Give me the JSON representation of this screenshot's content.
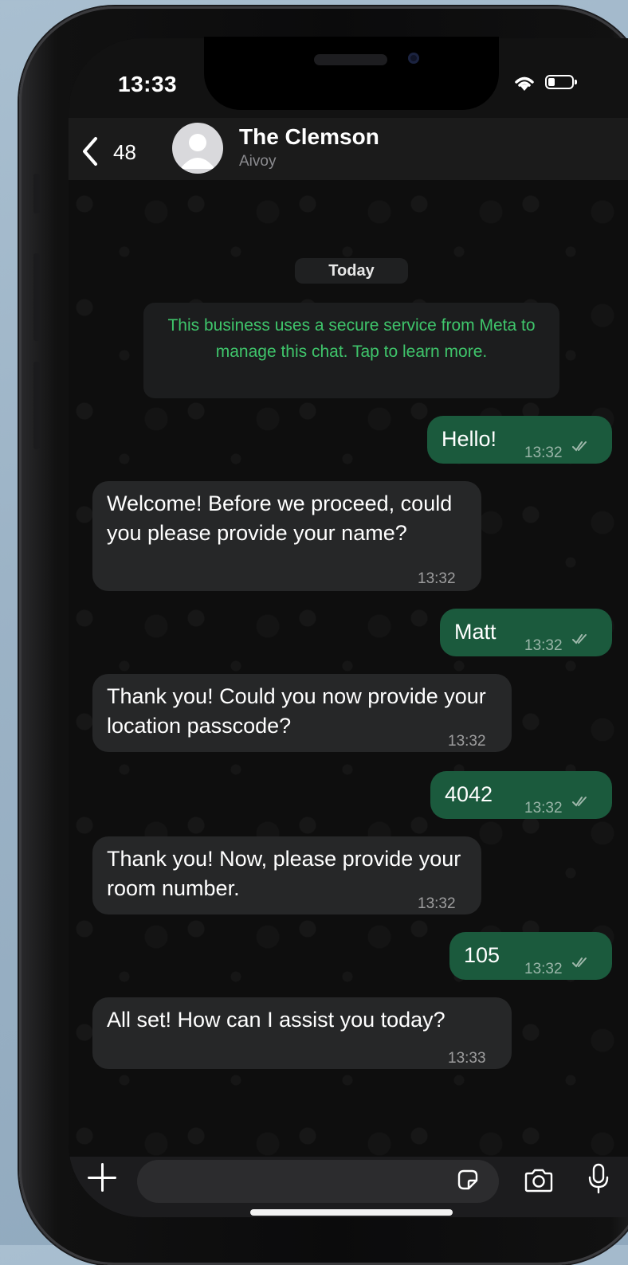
{
  "status_bar": {
    "time": "13:33"
  },
  "header": {
    "back_count": "48",
    "chat_name": "The Clemson",
    "chat_subtitle": "Aivoy"
  },
  "chat": {
    "date_label": "Today",
    "system_notice": "This business uses a secure service from Meta to manage this chat. Tap to learn more.",
    "messages": [
      {
        "direction": "outgoing",
        "text": "Hello!",
        "time": "13:32",
        "status": "read"
      },
      {
        "direction": "incoming",
        "text": "Welcome! Before we proceed, could you please provide your name?",
        "time": "13:32"
      },
      {
        "direction": "outgoing",
        "text": "Matt",
        "time": "13:32",
        "status": "read"
      },
      {
        "direction": "incoming",
        "text": "Thank you! Could you now provide your location passcode?",
        "time": "13:32"
      },
      {
        "direction": "outgoing",
        "text": "4042",
        "time": "13:32",
        "status": "read"
      },
      {
        "direction": "incoming",
        "text": "Thank you! Now, please provide your room number.",
        "time": "13:32"
      },
      {
        "direction": "outgoing",
        "text": "105",
        "time": "13:32",
        "status": "read"
      },
      {
        "direction": "incoming",
        "text": "All set! How can I assist you today?",
        "time": "13:33"
      }
    ]
  },
  "input_bar": {
    "placeholder": ""
  },
  "icons": {
    "back": "chevron-left-icon",
    "avatar": "person-icon",
    "attach": "plus-icon",
    "sticker": "sticker-icon",
    "camera": "camera-icon",
    "mic": "microphone-icon",
    "read": "double-check-icon",
    "wifi": "wifi-icon",
    "battery": "battery-icon"
  },
  "colors": {
    "outgoing_bubble": "#1b5a3d",
    "incoming_bubble": "#262728",
    "system_text": "#3fc56b",
    "chat_background": "#0e0e0e",
    "read_ticks": "#9fb8ab"
  }
}
